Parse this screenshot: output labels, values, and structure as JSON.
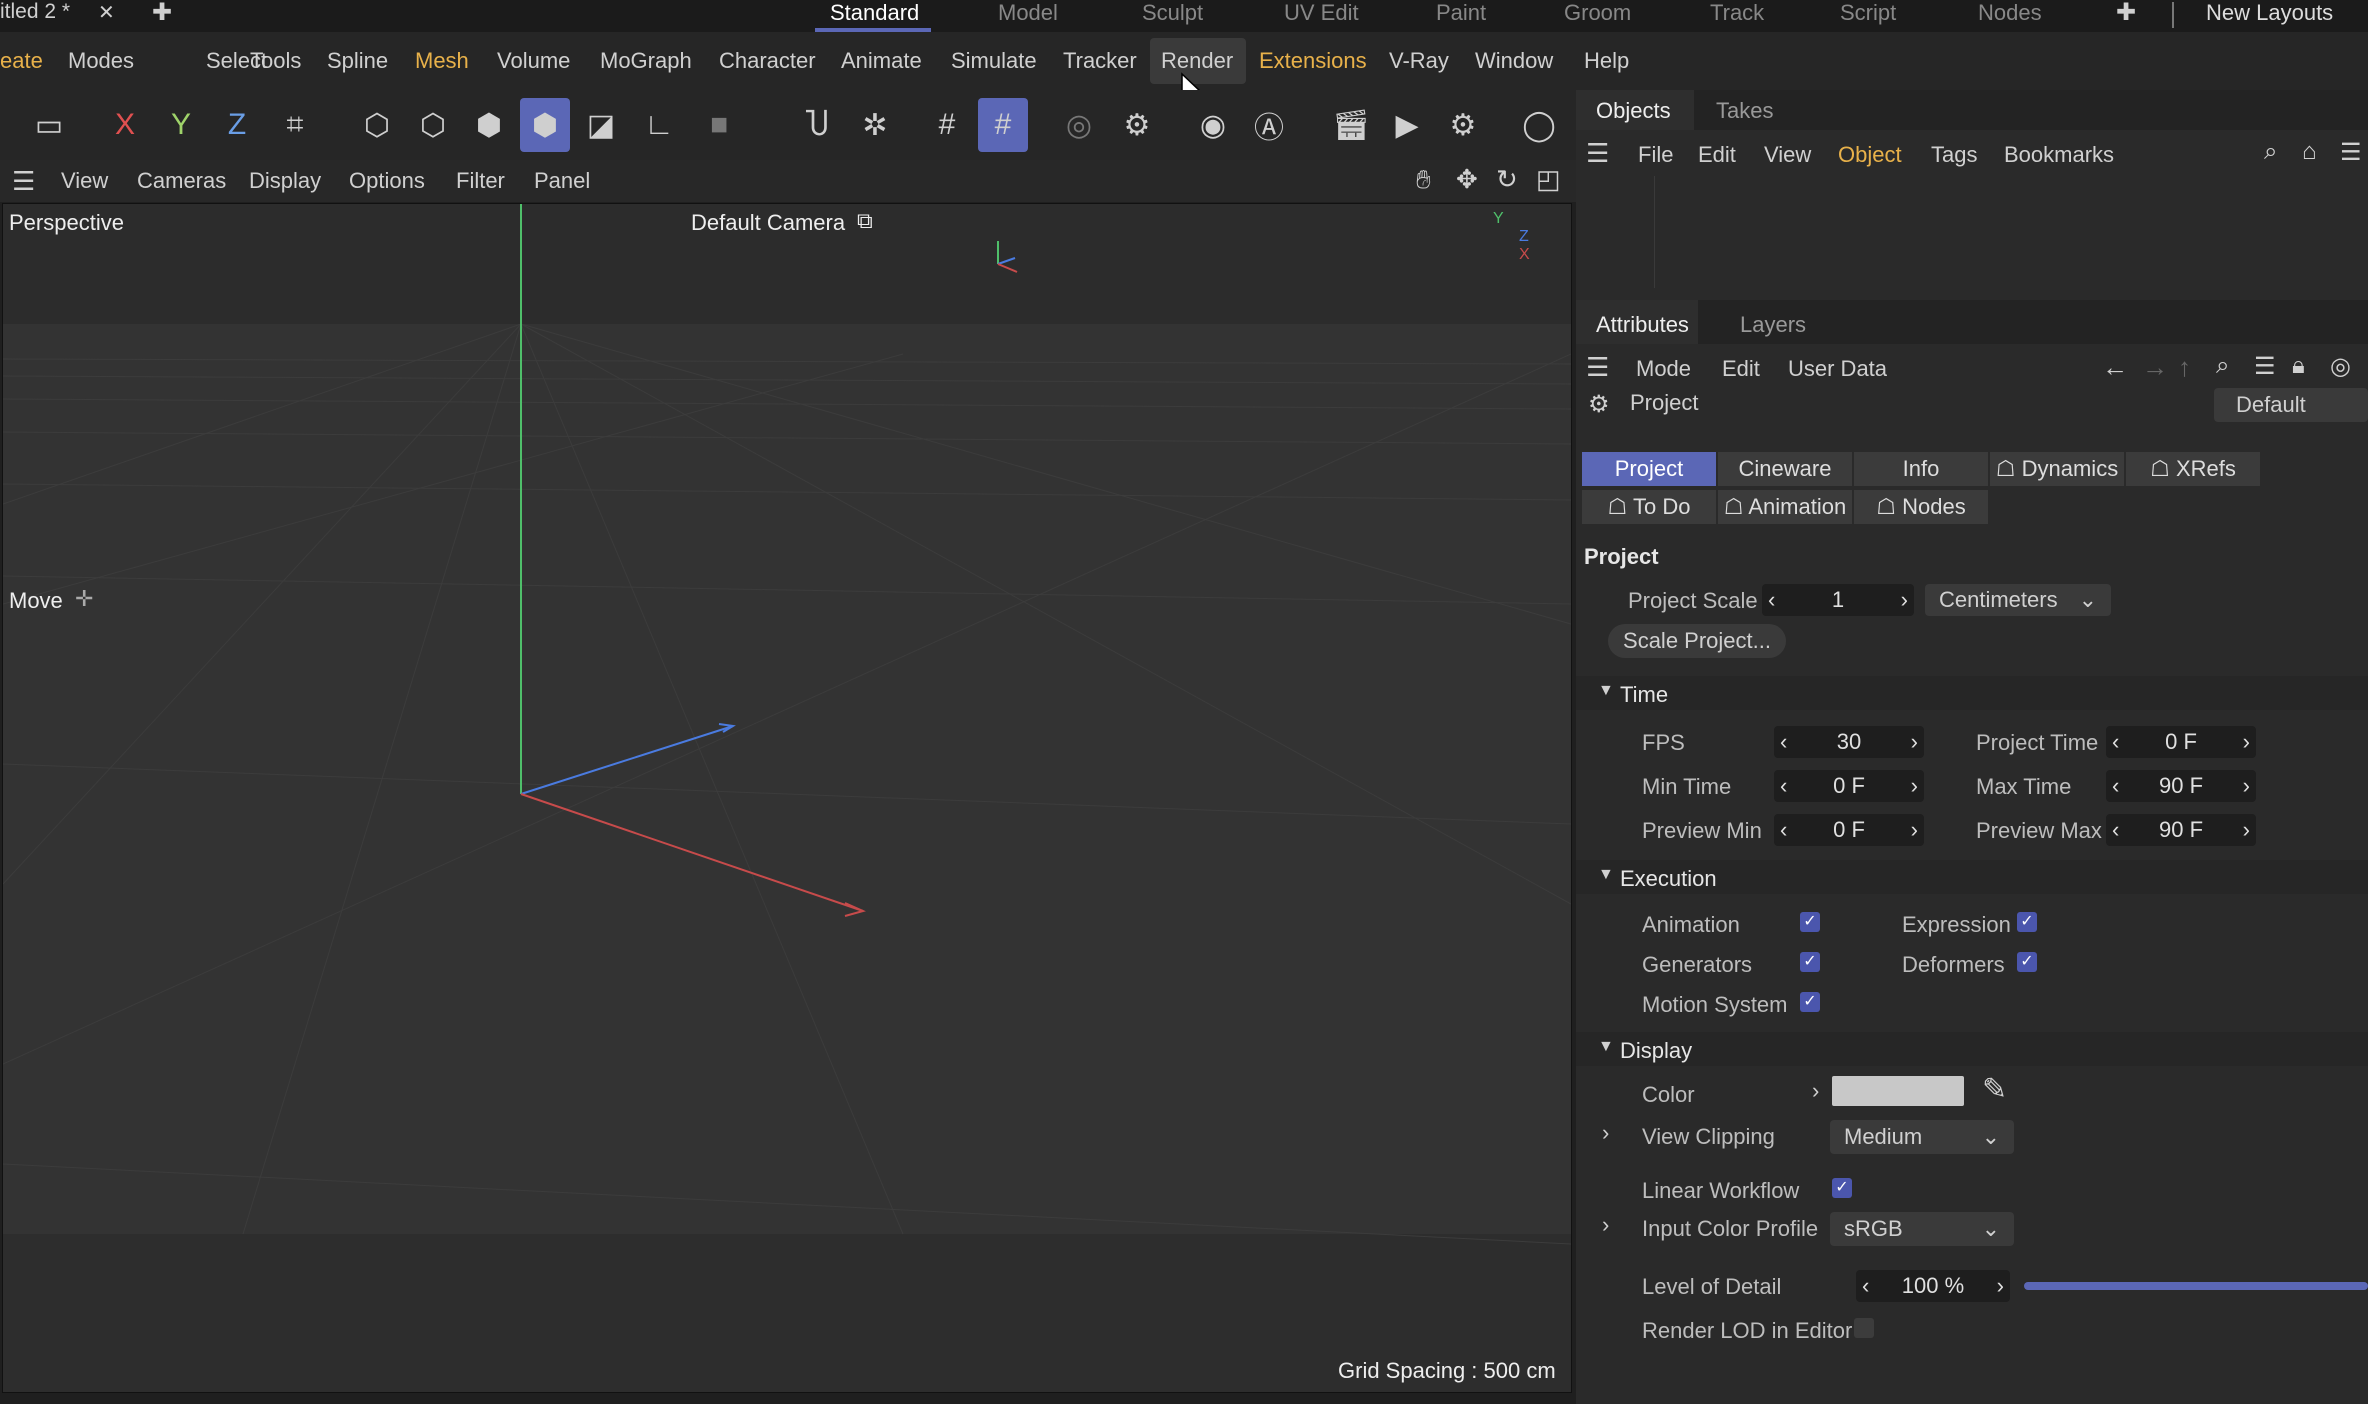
{
  "topbar": {
    "doc_title": "itled 2 *",
    "close": "✕",
    "plus": "✚",
    "layouts": [
      "Standard",
      "Model",
      "Sculpt",
      "UV Edit",
      "Paint",
      "Groom",
      "Track",
      "Script",
      "Nodes"
    ],
    "new_layouts": "New Layouts"
  },
  "menu": [
    "eate",
    "Modes",
    "Select",
    "Tools",
    "Spline",
    "Mesh",
    "Volume",
    "MoGraph",
    "Character",
    "Animate",
    "Simulate",
    "Tracker",
    "Render",
    "Extensions",
    "V-Ray",
    "Window",
    "Help"
  ],
  "viewport_menu": [
    "View",
    "Cameras",
    "Display",
    "Options",
    "Filter",
    "Panel"
  ],
  "viewport": {
    "label": "Perspective",
    "camera": "Default Camera",
    "tool": "Move",
    "grid": "Grid Spacing : 500 cm",
    "axis_y": "Y",
    "axis_z": "Z",
    "axis_x": "X"
  },
  "objects_panel": {
    "tabs": [
      "Objects",
      "Takes"
    ],
    "menu": [
      "File",
      "Edit",
      "View",
      "Object",
      "Tags",
      "Bookmarks"
    ]
  },
  "attributes_panel": {
    "tabs": [
      "Attributes",
      "Layers"
    ],
    "menu": [
      "Mode",
      "Edit",
      "User Data"
    ],
    "title": "Project",
    "preset": "Default",
    "tabs_row1": [
      "Project",
      "Cineware",
      "Info",
      "☖ Dynamics",
      "☖ XRefs"
    ],
    "tabs_row2": [
      "☖ To Do",
      "☖ Animation",
      "☖ Nodes"
    ]
  },
  "project": {
    "heading": "Project",
    "scale_label": "Project Scale",
    "scale_value": "1",
    "scale_unit": "Centimeters",
    "scale_button": "Scale Project..."
  },
  "time": {
    "heading": "Time",
    "fps_label": "FPS",
    "fps": "30",
    "project_time_label": "Project Time",
    "project_time": "0 F",
    "min_label": "Min Time",
    "min": "0 F",
    "max_label": "Max Time",
    "max": "90 F",
    "pmin_label": "Preview Min",
    "pmin": "0 F",
    "pmax_label": "Preview Max",
    "pmax": "90 F"
  },
  "execution": {
    "heading": "Execution",
    "animation": "Animation",
    "expression": "Expression",
    "generators": "Generators",
    "deformers": "Deformers",
    "motion": "Motion System"
  },
  "display": {
    "heading": "Display",
    "color_label": "Color",
    "clipping_label": "View Clipping",
    "clipping": "Medium",
    "linear_label": "Linear Workflow",
    "profile_label": "Input Color Profile",
    "profile": "sRGB",
    "lod_label": "Level of Detail",
    "lod": "100 %",
    "lod_level": 1.0,
    "render_lod_label": "Render LOD in Editor"
  },
  "colors": {
    "accent": "#5b67b6",
    "highlight": "#e8b14a"
  }
}
